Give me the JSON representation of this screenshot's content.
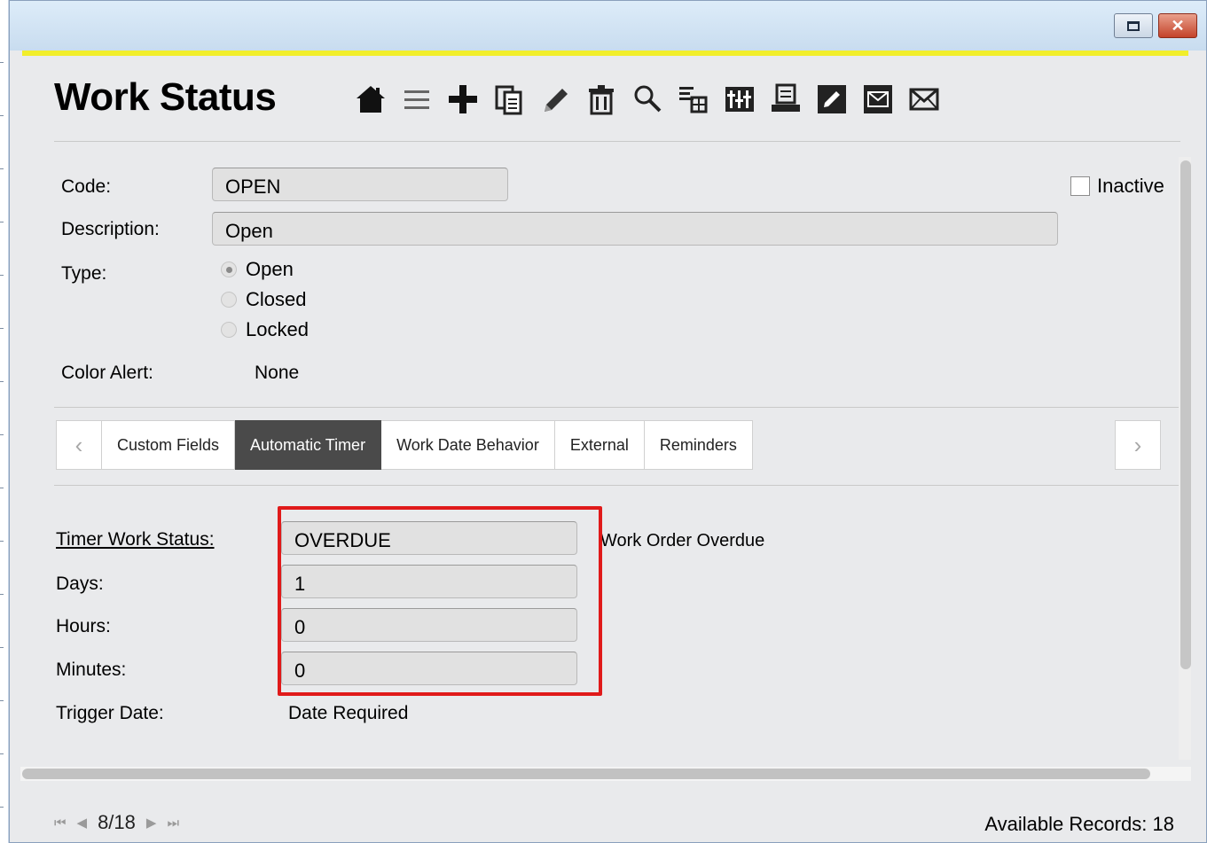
{
  "window": {
    "restore_label": "",
    "close_label": "✕"
  },
  "header": {
    "title": "Work Status",
    "toolbar": [
      "home-icon",
      "list-icon",
      "add-icon",
      "copy-icon",
      "edit-icon",
      "delete-icon",
      "search-icon",
      "filter-icon",
      "columns-icon",
      "settings-icon",
      "print-icon",
      "notes-icon",
      "email-icon",
      "email-alt-icon"
    ]
  },
  "form": {
    "code_label": "Code:",
    "code_value": "OPEN",
    "description_label": "Description:",
    "description_value": "Open",
    "type_label": "Type:",
    "type_options": [
      "Open",
      "Closed",
      "Locked"
    ],
    "type_selected": "Open",
    "color_alert_label": "Color Alert:",
    "color_alert_value": "None",
    "inactive_label": "Inactive"
  },
  "tabs": {
    "items": [
      "Custom Fields",
      "Automatic Timer",
      "Work Date Behavior",
      "External",
      "Reminders"
    ],
    "active": "Automatic Timer",
    "prev_glyph": "‹",
    "next_glyph": "›"
  },
  "timer": {
    "status_label": "Timer Work Status:",
    "status_value": "OVERDUE",
    "status_description": "Work Order Overdue",
    "days_label": "Days:",
    "days_value": "1",
    "hours_label": "Hours:",
    "hours_value": "0",
    "minutes_label": "Minutes:",
    "minutes_value": "0",
    "trigger_label": "Trigger Date:",
    "trigger_value": "Date Required"
  },
  "footer": {
    "first_glyph": "⏮",
    "prev_glyph": "◀",
    "position": "8/18",
    "next_glyph": "▶",
    "last_glyph": "⏭",
    "records_label": "Available Records:",
    "records_value": "18"
  },
  "colors": {
    "accent_line": "#f1ee2b",
    "highlight": "#e01a1a",
    "active_tab": "#4a4a4a"
  }
}
